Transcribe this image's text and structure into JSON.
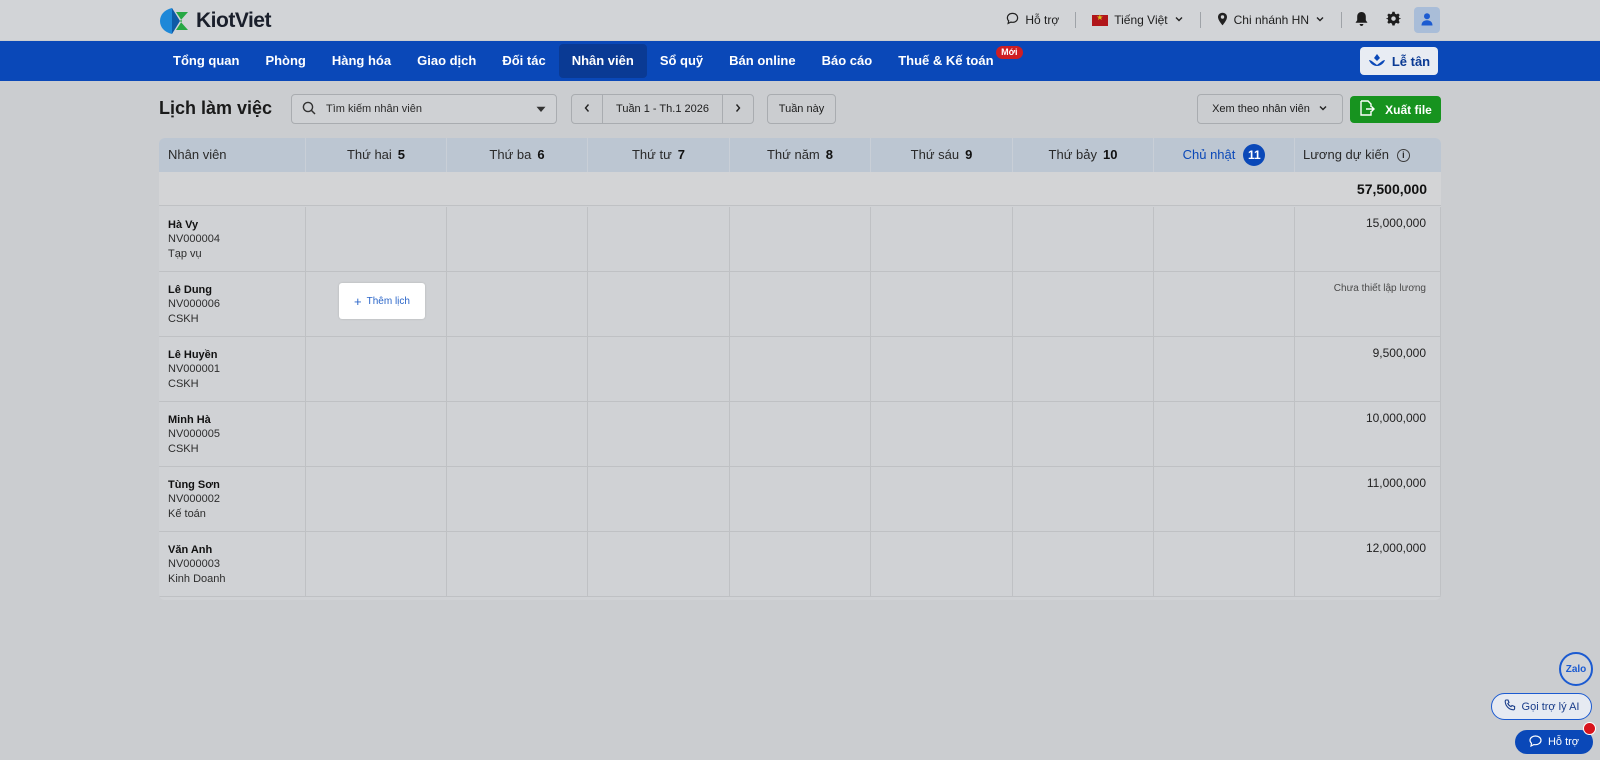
{
  "app": {
    "name": "KiotViet"
  },
  "topbar": {
    "support_label": "Hỗ trợ",
    "language_label": "Tiếng Việt",
    "branch_label": "Chi nhánh HN"
  },
  "nav": {
    "items": [
      {
        "label": "Tổng quan"
      },
      {
        "label": "Phòng"
      },
      {
        "label": "Hàng hóa"
      },
      {
        "label": "Giao dịch"
      },
      {
        "label": "Đối tác"
      },
      {
        "label": "Nhân viên"
      },
      {
        "label": "Sổ quỹ"
      },
      {
        "label": "Bán online"
      },
      {
        "label": "Báo cáo"
      },
      {
        "label": "Thuế & Kế toán"
      }
    ],
    "active_index": 5,
    "new_badge": "Mới",
    "reception_label": "Lễ tân"
  },
  "toolbar": {
    "title": "Lịch làm việc",
    "search_placeholder": "Tìm kiếm nhân viên",
    "week_label": "Tuần 1 - Th.1 2026",
    "this_week_label": "Tuần này",
    "view_by_label": "Xem theo nhân viên",
    "export_label": "Xuất file"
  },
  "table": {
    "employee_header": "Nhân viên",
    "days": [
      {
        "name": "Thứ hai",
        "date": "5"
      },
      {
        "name": "Thứ ba",
        "date": "6"
      },
      {
        "name": "Thứ tư",
        "date": "7"
      },
      {
        "name": "Thứ năm",
        "date": "8"
      },
      {
        "name": "Thứ sáu",
        "date": "9"
      },
      {
        "name": "Thứ bảy",
        "date": "10"
      },
      {
        "name": "Chủ nhật",
        "date": "11"
      }
    ],
    "salary_header": "Lương dự kiến",
    "total_salary": "57,500,000",
    "add_schedule_label": "Thêm lịch",
    "rows": [
      {
        "name": "Hà Vy",
        "code": "NV000004",
        "role": "Tạp vụ",
        "salary": "15,000,000"
      },
      {
        "name": "Lê Dung",
        "code": "NV000006",
        "role": "CSKH",
        "salary": "Chưa thiết lập lương"
      },
      {
        "name": "Lê Huyền",
        "code": "NV000001",
        "role": "CSKH",
        "salary": "9,500,000"
      },
      {
        "name": "Minh Hà",
        "code": "NV000005",
        "role": "CSKH",
        "salary": "10,000,000"
      },
      {
        "name": "Tùng Sơn",
        "code": "NV000002",
        "role": "Kế toán",
        "salary": "11,000,000"
      },
      {
        "name": "Văn Anh",
        "code": "NV000003",
        "role": "Kinh Doanh",
        "salary": "12,000,000"
      }
    ]
  },
  "widgets": {
    "zalo_label": "Zalo",
    "ai_label": "Gọi trợ lý AI",
    "help_label": "Hỗ trợ"
  },
  "colors": {
    "primary": "#0a48b8",
    "export_green": "#17931f",
    "badge_red": "#cf1e23"
  }
}
